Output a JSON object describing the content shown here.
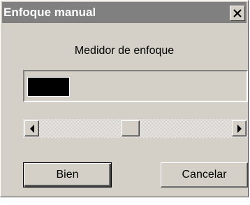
{
  "window": {
    "title": "Enfoque manual",
    "close_icon": "close-icon"
  },
  "focus_meter": {
    "heading": "Medidor de enfoque",
    "level": 0.19
  },
  "focus_slider": {
    "position": 0.47
  },
  "buttons": {
    "ok_label": "Bien",
    "cancel_label": "Cancelar"
  },
  "colors": {
    "titlebar": "#808080",
    "dialog": "#d4d0c8",
    "meter_fill": "#000000"
  }
}
